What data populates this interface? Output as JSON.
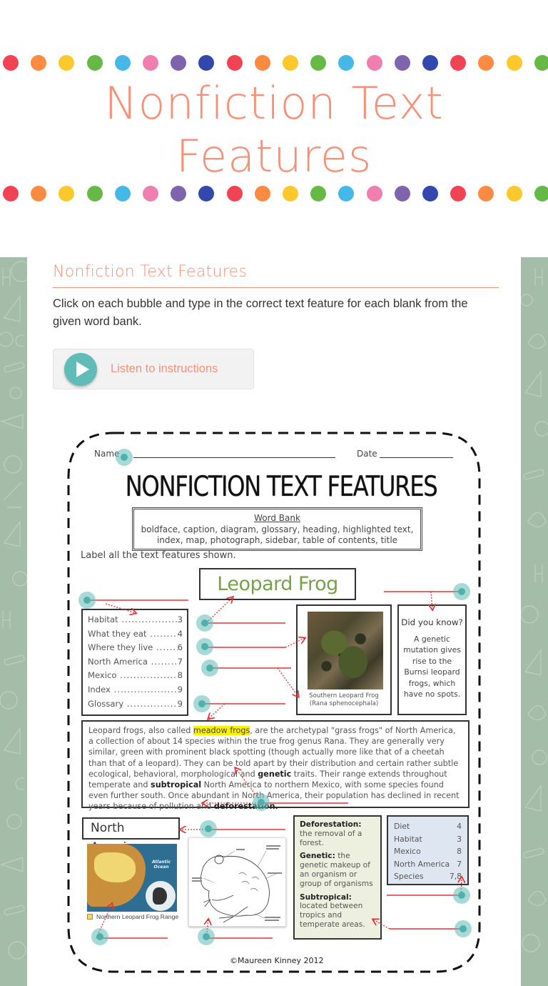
{
  "hero": {
    "title_line1": "Nonfiction Text",
    "title_line2": "Features",
    "dot_colors": [
      "#f04455",
      "#fb8a42",
      "#fdc82c",
      "#66b946",
      "#46b8e8",
      "#f07fb0",
      "#7f63ad",
      "#3348ad"
    ]
  },
  "activity": {
    "section_title": "Nonfiction Text Features",
    "instructions": "Click on each bubble and type in the correct text feature for each blank from the given word bank.",
    "listen_button": "Listen to instructions"
  },
  "worksheet": {
    "name_label": "Name",
    "date_label": "Date",
    "title": "NONFICTION TEXT FEATURES",
    "word_bank": {
      "title": "Word Bank",
      "line1": "boldface, caption, diagram, glossary, heading, highlighted text,",
      "line2": "index, map, photograph, sidebar, table of contents, title"
    },
    "label_instruction": "Label all the text features shown.",
    "heading": "Leopard Frog",
    "toc": [
      {
        "label": "Habitat",
        "page": "3"
      },
      {
        "label": "What they eat",
        "page": "4"
      },
      {
        "label": "Where they live",
        "page": "6"
      },
      {
        "label": "North America",
        "page": "7"
      },
      {
        "label": "Mexico",
        "page": "8"
      },
      {
        "label": "Index",
        "page": "9"
      },
      {
        "label": "Glossary",
        "page": "9"
      }
    ],
    "photo_caption_line1": "Southern Leopard Frog",
    "photo_caption_line2": "(Rana sphenocephala)",
    "sidebar": {
      "title": "Did you know?",
      "text": "A genetic mutation gives rise to the Burnsi leopard frogs, which have no spots."
    },
    "passage": {
      "p1": "Leopard frogs, also called ",
      "highlight": "meadow frogs",
      "p2": ", are the archetypal \"grass frogs\" of North America, a collection of about 14 species within the true frog genus Rana. They are generally very similar, green with prominent black spotting (though actually more like that of a cheetah than that of a leopard). They can be told apart by their distribution and certain rather subtle ecological, behavioral, morphological and ",
      "bold1": "genetic",
      "p3": " traits. Their range extends throughout temperate and ",
      "bold2": "subtropical",
      "p4": " North America to northern Mexico, with some species found even further south. Once abundant in North America, their population has declined in recent years because of pollution and ",
      "bold3": "deforestation.",
      "p5": ""
    },
    "map_heading": "North America",
    "map_ocean_label": "Atlantic Ocean",
    "map_legend": "Northern Leopard Frog Range",
    "glossary": [
      {
        "term": "Deforestation:",
        "def": " the removal of a forest."
      },
      {
        "term": "Genetic:",
        "def": " the genetic makeup of an organism or group of organisms"
      },
      {
        "term": "Subtropical:",
        "def": " located between tropics and temperate areas."
      }
    ],
    "index": [
      {
        "label": "Diet",
        "page": "4"
      },
      {
        "label": "Habitat",
        "page": "3"
      },
      {
        "label": "Mexico",
        "page": "8"
      },
      {
        "label": "North America",
        "page": "7"
      },
      {
        "label": "Species",
        "page": "7,8"
      }
    ],
    "copyright": "©Maureen Kinney 2012"
  },
  "answer_bubbles": [
    {
      "id": "name",
      "answer": ""
    },
    {
      "id": "toc",
      "answer": ""
    },
    {
      "id": "heading",
      "answer": ""
    },
    {
      "id": "photo",
      "answer": ""
    },
    {
      "id": "caption",
      "answer": ""
    },
    {
      "id": "highlighted",
      "answer": ""
    },
    {
      "id": "sidebar",
      "answer": ""
    },
    {
      "id": "boldface",
      "answer": ""
    },
    {
      "id": "subheading",
      "answer": ""
    },
    {
      "id": "map",
      "answer": ""
    },
    {
      "id": "diagram",
      "answer": ""
    },
    {
      "id": "index",
      "answer": ""
    },
    {
      "id": "glossary",
      "answer": ""
    }
  ],
  "colors": {
    "accent": "#f4917a",
    "bubble": "#5fbcb6",
    "side_pattern": "#a4bda8",
    "heading_green": "#76a04a",
    "highlight": "#fff200",
    "line_red": "#e53238"
  }
}
